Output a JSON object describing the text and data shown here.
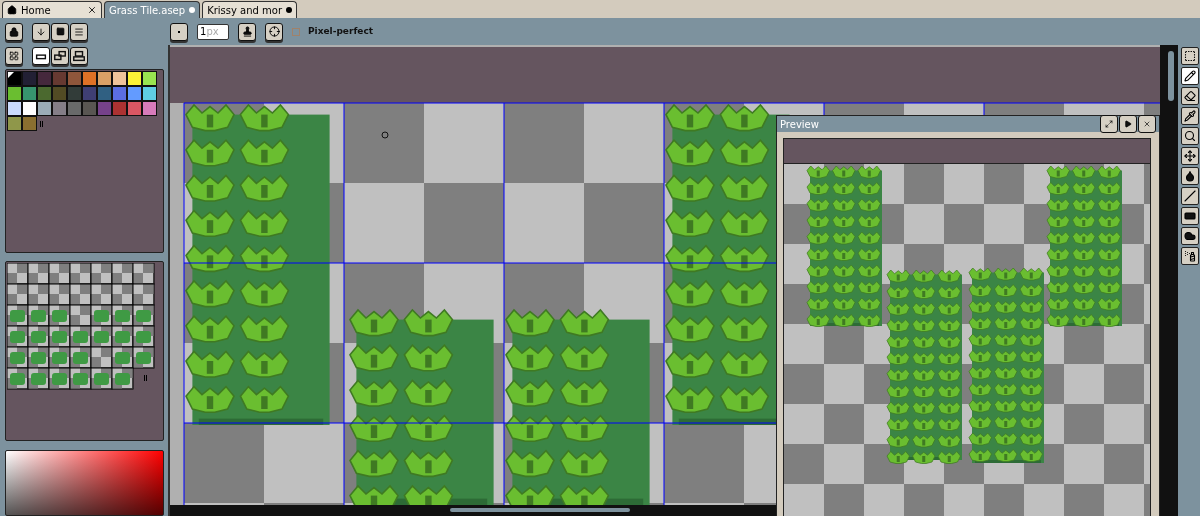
{
  "tabs": [
    {
      "label": "Home",
      "selected": false,
      "modified": false,
      "kind": "home"
    },
    {
      "label": "Grass Tile.asep",
      "selected": true,
      "modified": true,
      "kind": "file"
    },
    {
      "label": "Krissy and mor",
      "selected": false,
      "modified": true,
      "kind": "file"
    }
  ],
  "toolbar": {
    "brush_size": {
      "value": "1",
      "unit": "px"
    },
    "pixel_perfect": {
      "label": "Pixel-perfect",
      "checked": false
    }
  },
  "layer_modes": [
    {
      "kind": "single",
      "selected": true
    },
    {
      "kind": "stack",
      "selected": false
    },
    {
      "kind": "base",
      "selected": false
    }
  ],
  "palette": {
    "colors": [
      {
        "color": "#000000",
        "selected": true
      },
      {
        "color": "#222034",
        "selected": false
      },
      {
        "color": "#45283c",
        "selected": false
      },
      {
        "color": "#663931",
        "selected": false
      },
      {
        "color": "#8f563b",
        "selected": false
      },
      {
        "color": "#df7126",
        "selected": false
      },
      {
        "color": "#d9a066",
        "selected": false
      },
      {
        "color": "#eec39a",
        "selected": false
      },
      {
        "color": "#fbf236",
        "selected": false
      },
      {
        "color": "#99e550",
        "selected": false
      },
      {
        "color": "#6abe30",
        "selected": false
      },
      {
        "color": "#37946e",
        "selected": false
      },
      {
        "color": "#4b692f",
        "selected": false
      },
      {
        "color": "#524b24",
        "selected": false
      },
      {
        "color": "#323c39",
        "selected": false
      },
      {
        "color": "#3f3f74",
        "selected": false
      },
      {
        "color": "#306082",
        "selected": false
      },
      {
        "color": "#5b6ee1",
        "selected": false
      },
      {
        "color": "#639bff",
        "selected": false
      },
      {
        "color": "#5fcde4",
        "selected": false
      },
      {
        "color": "#cbdbfc",
        "selected": false
      },
      {
        "color": "#ffffff",
        "selected": false
      },
      {
        "color": "#9badb7",
        "selected": false
      },
      {
        "color": "#847e87",
        "selected": false
      },
      {
        "color": "#696a6a",
        "selected": false
      },
      {
        "color": "#595652",
        "selected": false
      },
      {
        "color": "#76428a",
        "selected": false
      },
      {
        "color": "#ac3232",
        "selected": false
      },
      {
        "color": "#d95763",
        "selected": false
      },
      {
        "color": "#d77bba",
        "selected": false
      },
      {
        "color": "#8f974a",
        "selected": false
      },
      {
        "color": "#8a6f30",
        "selected": false
      }
    ]
  },
  "preview": {
    "title": "Preview"
  },
  "tools": [
    {
      "kind": "marquee",
      "selected": false
    },
    {
      "kind": "pencil",
      "selected": true
    },
    {
      "kind": "eraser",
      "selected": false
    },
    {
      "kind": "eyedropper",
      "selected": false
    },
    {
      "kind": "zoom",
      "selected": false
    },
    {
      "kind": "move",
      "selected": false
    },
    {
      "kind": "fill",
      "selected": false
    },
    {
      "kind": "line",
      "selected": false
    },
    {
      "kind": "rectangle",
      "selected": false
    },
    {
      "kind": "blob",
      "selected": false
    },
    {
      "kind": "spray",
      "selected": false
    }
  ]
}
